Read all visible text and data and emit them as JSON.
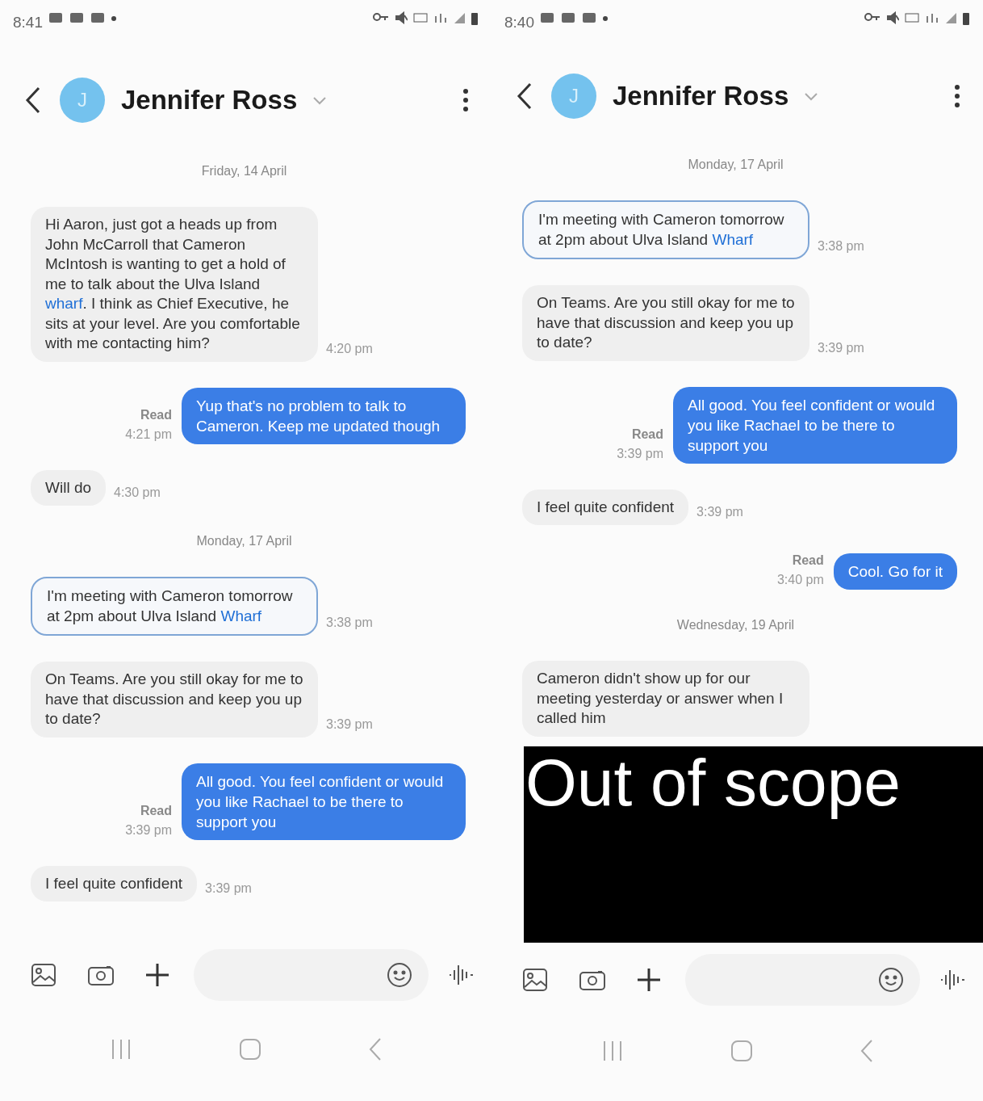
{
  "phones": [
    {
      "status_bar": {
        "time": "8:41"
      },
      "header": {
        "avatar_initial": "J",
        "contact": "Jennifer Ross"
      },
      "messages": [
        {
          "kind": "date",
          "text": "Friday, 14 April"
        },
        {
          "kind": "incoming",
          "outlined": false,
          "segments": [
            {
              "kind": "plain",
              "text": "Hi Aaron, just got a heads up from John McCarroll that Cameron McIntosh is wanting to get a hold of me to talk about the Ulva Island "
            },
            {
              "kind": "link",
              "text": "wharf"
            },
            {
              "kind": "plain",
              "text": ". I think as Chief Executive, he sits at your level. Are you comfortable with me contacting him?"
            }
          ],
          "time": "4:20 pm"
        },
        {
          "kind": "outgoing",
          "segments": [
            {
              "kind": "plain",
              "text": "Yup that's no problem to talk to Cameron. Keep me updated though"
            }
          ],
          "status": "Read",
          "time": "4:21 pm"
        },
        {
          "kind": "incoming",
          "outlined": false,
          "segments": [
            {
              "kind": "plain",
              "text": "Will do"
            }
          ],
          "time": "4:30 pm"
        },
        {
          "kind": "date",
          "text": "Monday, 17 April"
        },
        {
          "kind": "incoming",
          "outlined": true,
          "segments": [
            {
              "kind": "plain",
              "text": "I'm meeting with Cameron tomorrow at 2pm about Ulva Island "
            },
            {
              "kind": "link",
              "text": "Wharf"
            }
          ],
          "time": "3:38 pm"
        },
        {
          "kind": "incoming",
          "outlined": false,
          "segments": [
            {
              "kind": "plain",
              "text": "On Teams. Are you still okay for me to have that discussion and keep you up to date?"
            }
          ],
          "time": "3:39 pm"
        },
        {
          "kind": "outgoing",
          "segments": [
            {
              "kind": "plain",
              "text": "All good. You feel confident or would you like Rachael to be there to support you"
            }
          ],
          "status": "Read",
          "time": "3:39 pm"
        },
        {
          "kind": "incoming",
          "outlined": false,
          "segments": [
            {
              "kind": "plain",
              "text": "I feel quite confident"
            }
          ],
          "time": "3:39 pm"
        }
      ]
    },
    {
      "status_bar": {
        "time": "8:40"
      },
      "header": {
        "avatar_initial": "J",
        "contact": "Jennifer Ross"
      },
      "messages": [
        {
          "kind": "date",
          "text": "Monday, 17 April"
        },
        {
          "kind": "incoming",
          "outlined": true,
          "segments": [
            {
              "kind": "plain",
              "text": "I'm meeting with Cameron tomorrow at 2pm about Ulva Island "
            },
            {
              "kind": "link",
              "text": "Wharf"
            }
          ],
          "time": "3:38 pm"
        },
        {
          "kind": "incoming",
          "outlined": false,
          "segments": [
            {
              "kind": "plain",
              "text": "On Teams. Are you still okay for me to have that discussion and keep you up to date?"
            }
          ],
          "time": "3:39 pm"
        },
        {
          "kind": "outgoing",
          "segments": [
            {
              "kind": "plain",
              "text": "All good. You feel confident or would you like Rachael to be there to support you"
            }
          ],
          "status": "Read",
          "time": "3:39 pm"
        },
        {
          "kind": "incoming",
          "outlined": false,
          "segments": [
            {
              "kind": "plain",
              "text": "I feel quite confident"
            }
          ],
          "time": "3:39 pm"
        },
        {
          "kind": "outgoing",
          "segments": [
            {
              "kind": "plain",
              "text": "Cool. Go for it"
            }
          ],
          "status": "Read",
          "time": "3:40 pm"
        },
        {
          "kind": "date",
          "text": "Wednesday, 19 April"
        },
        {
          "kind": "incoming",
          "outlined": false,
          "segments": [
            {
              "kind": "plain",
              "text": "Cameron didn't show up for our meeting yesterday or answer when I called him"
            }
          ]
        }
      ],
      "redaction": {
        "text": "Out of scope"
      }
    }
  ]
}
